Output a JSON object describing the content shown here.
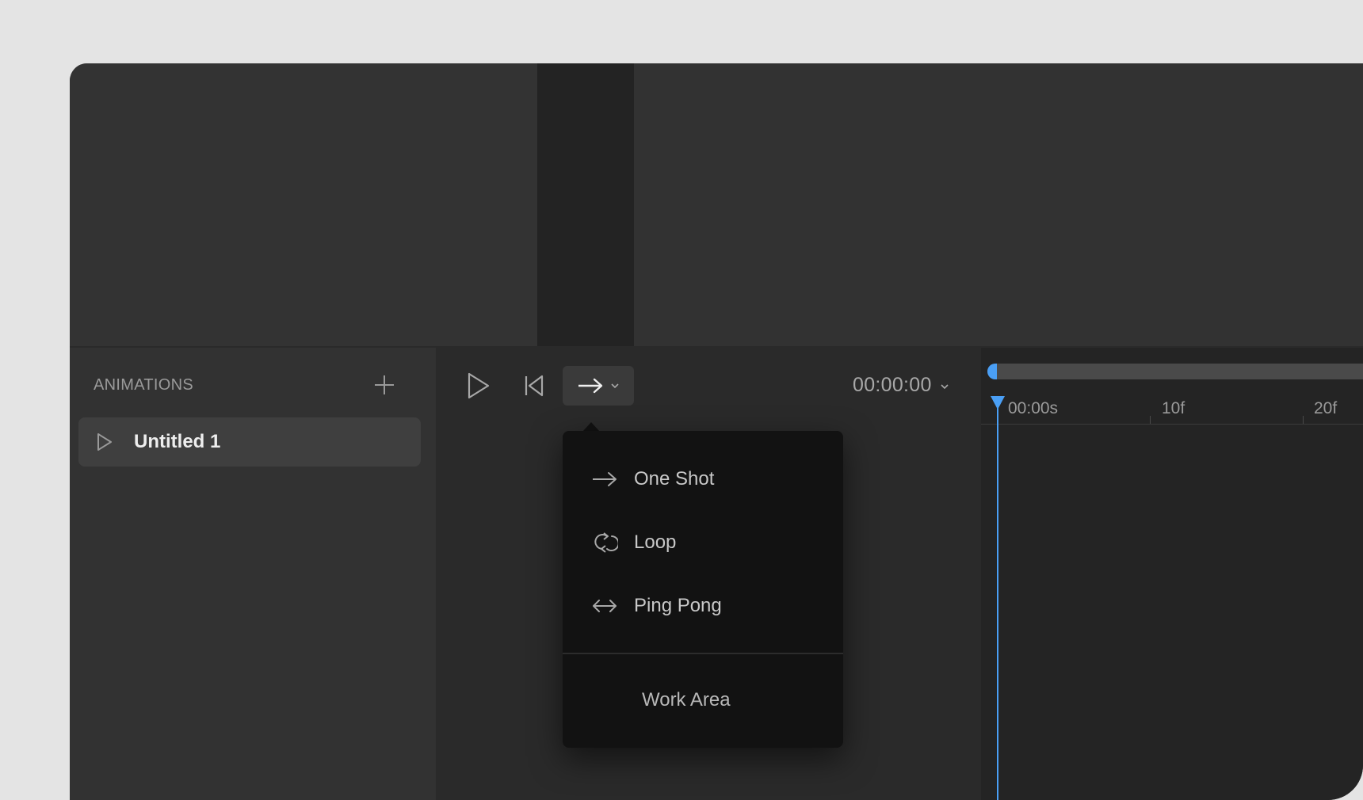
{
  "animations_panel": {
    "title": "ANIMATIONS",
    "items": [
      {
        "label": "Untitled 1"
      }
    ]
  },
  "transport": {
    "time": "00:00:00"
  },
  "timeline": {
    "ticks": [
      "00:00s",
      "10f",
      "20f"
    ]
  },
  "mode_menu": {
    "items": [
      {
        "label": "One Shot",
        "icon": "arrow-right-icon"
      },
      {
        "label": "Loop",
        "icon": "loop-icon"
      },
      {
        "label": "Ping Pong",
        "icon": "ping-pong-icon"
      }
    ],
    "work_area": "Work Area"
  },
  "colors": {
    "accent": "#4a9ff5",
    "menu_bg": "#121212",
    "panel_bg": "#323232"
  }
}
